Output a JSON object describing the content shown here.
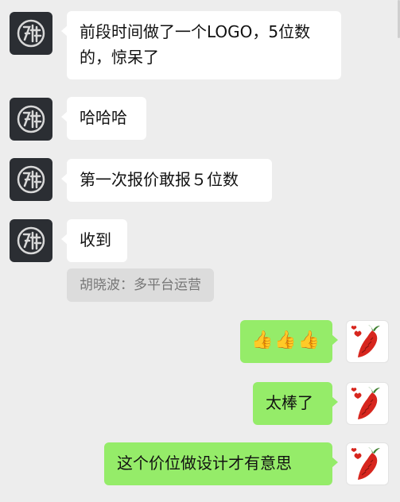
{
  "messages": {
    "m1": {
      "text": "前段时间做了一个LOGO，5位数的，惊呆了"
    },
    "m2": {
      "text": "哈哈哈"
    },
    "m3": {
      "text": "第一次报价敢报５位数"
    },
    "m4": {
      "text": "收到"
    },
    "quote": {
      "text": "胡晓波：多平台运营"
    },
    "r1": {
      "emoji": [
        "👍",
        "👍",
        "👍"
      ]
    },
    "r2": {
      "text": "太棒了"
    },
    "r3": {
      "text": "这个价位做设计才有意思"
    }
  },
  "icons": {
    "left_avatar": "stylized-glyph-avatar",
    "right_avatar": "radish-avatar",
    "thumbs": "thumbs-up-icon"
  },
  "colors": {
    "background": "#ededed",
    "incoming_bubble": "#ffffff",
    "outgoing_bubble": "#95ec69",
    "quote_bubble": "#dcdcdc",
    "avatar_dark": "#2b2e33"
  }
}
